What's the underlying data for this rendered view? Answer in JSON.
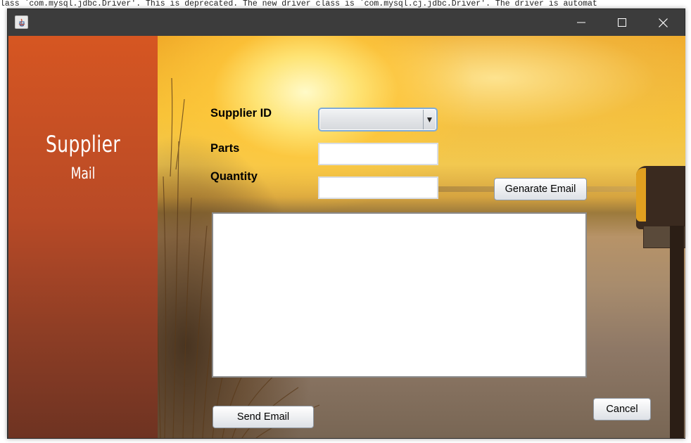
{
  "console": {
    "message": "lass `com.mysql.jdbc.Driver'. This is deprecated. The new driver class is `com.mysql.cj.jdbc.Driver'. The driver is automat"
  },
  "window": {
    "title": "",
    "controls": {
      "minimize": "minimize-icon",
      "maximize": "maximize-icon",
      "close": "close-icon"
    }
  },
  "sidebar": {
    "title": "Supplier",
    "subtitle": "Mail"
  },
  "form": {
    "supplier_id_label": "Supplier ID",
    "supplier_id_value": "",
    "parts_label": "Parts",
    "parts_value": "",
    "quantity_label": "Quantity",
    "quantity_value": "",
    "email_body": ""
  },
  "buttons": {
    "generate": "Genarate Email",
    "send": "Send Email",
    "cancel": "Cancel"
  },
  "colors": {
    "sidebar_top": "#d65622",
    "sidebar_bottom": "#6e3322",
    "titlebar": "#3c3c3c",
    "combo_border": "#7faad6"
  }
}
